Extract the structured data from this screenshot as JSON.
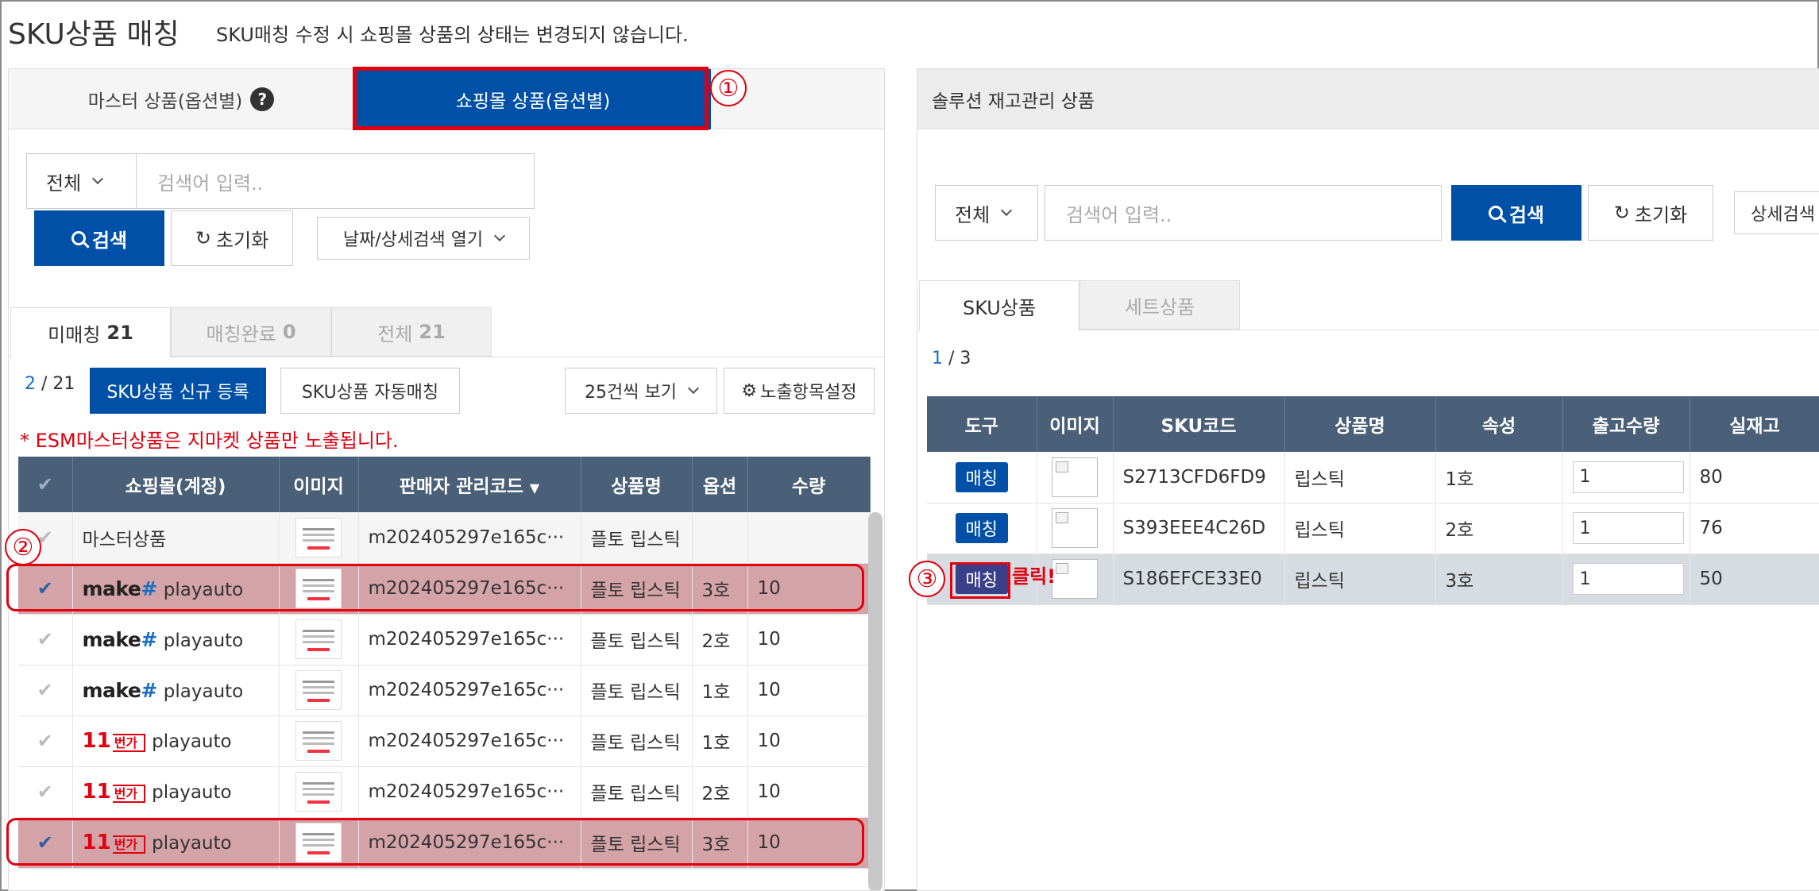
{
  "header": {
    "title": "SKU상품 매칭",
    "notice": "SKU매칭 수정 시 쇼핑몰 상품의 상태는 변경되지 않습니다."
  },
  "left": {
    "tabs": [
      "마스터 상품(옵션별)",
      "쇼핑몰 상품(옵션별)"
    ],
    "help_icon": "?",
    "search": {
      "select": "전체",
      "placeholder": "검색어 입력..",
      "search_btn": "검색",
      "reset_btn": "초기화",
      "detail_btn": "날짜/상세검색 열기"
    },
    "subtabs": [
      {
        "label": "미매칭",
        "count": "21"
      },
      {
        "label": "매칭완료",
        "count": "0"
      },
      {
        "label": "전체",
        "count": "21"
      }
    ],
    "pager": {
      "current": "2",
      "sep": " / ",
      "total": "21"
    },
    "toolbar": {
      "register": "SKU상품 신규 등록",
      "auto": "SKU상품 자동매칭",
      "page_size": "25건씩 보기",
      "columns": "노출항목설정"
    },
    "esm_note": "* ESM마스터상품은 지마켓 상품만 노출됩니다.",
    "columns": [
      "쇼핑몰(계정)",
      "이미지",
      "판매자 관리코드",
      "상품명",
      "옵션",
      "수량"
    ],
    "sort_icon": "▼",
    "rows": [
      {
        "shop": "마스터상품",
        "brand": "",
        "account": "",
        "code": "m202405297e165c···",
        "name": "플토 립스틱",
        "option": "",
        "qty": ""
      },
      {
        "shop": "make#",
        "brand": "make",
        "account": "playauto",
        "code": "m202405297e165c···",
        "name": "플토 립스틱",
        "option": "3호",
        "qty": "10"
      },
      {
        "shop": "make#",
        "brand": "make",
        "account": "playauto",
        "code": "m202405297e165c···",
        "name": "플토 립스틱",
        "option": "2호",
        "qty": "10"
      },
      {
        "shop": "make#",
        "brand": "make",
        "account": "playauto",
        "code": "m202405297e165c···",
        "name": "플토 립스틱",
        "option": "1호",
        "qty": "10"
      },
      {
        "shop": "11번가",
        "brand": "11",
        "account": "playauto",
        "code": "m202405297e165c···",
        "name": "플토 립스틱",
        "option": "1호",
        "qty": "10"
      },
      {
        "shop": "11번가",
        "brand": "11",
        "account": "playauto",
        "code": "m202405297e165c···",
        "name": "플토 립스틱",
        "option": "2호",
        "qty": "10"
      },
      {
        "shop": "11번가",
        "brand": "11",
        "account": "playauto",
        "code": "m202405297e165c···",
        "name": "플토 립스틱",
        "option": "3호",
        "qty": "10"
      }
    ],
    "brand_make": {
      "word": "make",
      "mark": "#"
    },
    "brand_11": {
      "num": "11",
      "word": "번가"
    }
  },
  "right": {
    "header": "솔루션 재고관리 상품",
    "search": {
      "select": "전체",
      "placeholder": "검색어 입력..",
      "search_btn": "검색",
      "reset_btn": "초기화",
      "detail_btn": "상세검색"
    },
    "subtabs": [
      "SKU상품",
      "세트상품"
    ],
    "pager": {
      "current": "1",
      "sep": " / ",
      "total": "3"
    },
    "columns": [
      "도구",
      "이미지",
      "SKU코드",
      "상품명",
      "속성",
      "출고수량",
      "실재고"
    ],
    "match_btn": "매칭",
    "click_note": "클릭!",
    "rows": [
      {
        "sku": "S2713CFD6FD9",
        "name": "립스틱",
        "attr": "1호",
        "out": "1",
        "stock": "80"
      },
      {
        "sku": "S393EEE4C26D",
        "name": "립스틱",
        "attr": "2호",
        "out": "1",
        "stock": "76"
      },
      {
        "sku": "S186EFCE33E0",
        "name": "립스틱",
        "attr": "3호",
        "out": "1",
        "stock": "50"
      }
    ]
  },
  "callouts": [
    "①",
    "②",
    "③"
  ]
}
